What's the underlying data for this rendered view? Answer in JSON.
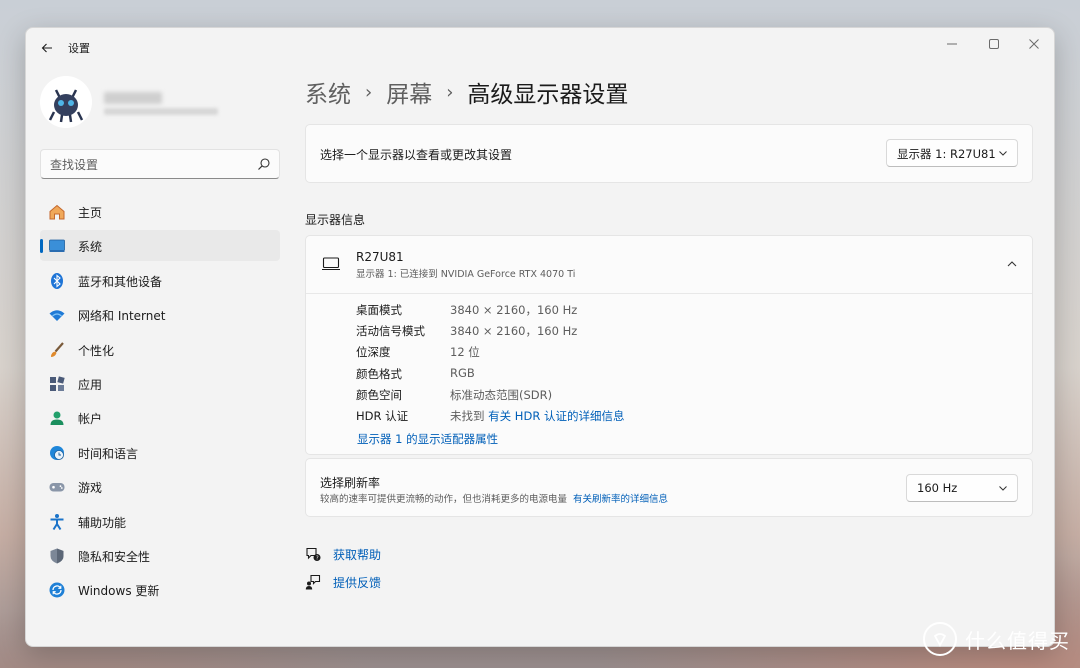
{
  "window": {
    "title": "设置"
  },
  "search": {
    "placeholder": "查找设置"
  },
  "sidebar": {
    "items": [
      {
        "label": "主页",
        "icon": "home-icon"
      },
      {
        "label": "系统",
        "icon": "system-icon",
        "active": true
      },
      {
        "label": "蓝牙和其他设备",
        "icon": "bluetooth-icon"
      },
      {
        "label": "网络和 Internet",
        "icon": "wifi-icon"
      },
      {
        "label": "个性化",
        "icon": "brush-icon"
      },
      {
        "label": "应用",
        "icon": "apps-icon"
      },
      {
        "label": "帐户",
        "icon": "account-icon"
      },
      {
        "label": "时间和语言",
        "icon": "clock-globe-icon"
      },
      {
        "label": "游戏",
        "icon": "gamepad-icon"
      },
      {
        "label": "辅助功能",
        "icon": "accessibility-icon"
      },
      {
        "label": "隐私和安全性",
        "icon": "shield-icon"
      },
      {
        "label": "Windows 更新",
        "icon": "update-icon"
      }
    ]
  },
  "breadcrumb": {
    "level1": "系统",
    "level2": "屏幕",
    "current": "高级显示器设置"
  },
  "display_select": {
    "label": "选择一个显示器以查看或更改其设置",
    "selected": "显示器 1: R27U81"
  },
  "display_info": {
    "section_title": "显示器信息",
    "name": "R27U81",
    "subtitle": "显示器 1: 已连接到 NVIDIA GeForce RTX 4070 Ti",
    "rows": [
      {
        "key": "桌面模式",
        "value": "3840 × 2160，160 Hz"
      },
      {
        "key": "活动信号模式",
        "value": "3840 × 2160，160 Hz"
      },
      {
        "key": "位深度",
        "value": "12 位"
      },
      {
        "key": "颜色格式",
        "value": "RGB"
      },
      {
        "key": "颜色空间",
        "value": "标准动态范围(SDR)"
      }
    ],
    "hdr": {
      "key": "HDR 认证",
      "value": "未找到",
      "link": "有关 HDR 认证的详细信息"
    },
    "adapter_link": "显示器 1 的显示适配器属性"
  },
  "refresh": {
    "title": "选择刷新率",
    "description": "较高的速率可提供更流畅的动作，但也消耗更多的电源电量",
    "link": "有关刷新率的详细信息",
    "selected": "160 Hz"
  },
  "help": {
    "get_help": "获取帮助",
    "feedback": "提供反馈"
  },
  "watermark": {
    "text": "什么值得买"
  },
  "colors": {
    "accent": "#0067c0",
    "link": "#005fb8"
  }
}
